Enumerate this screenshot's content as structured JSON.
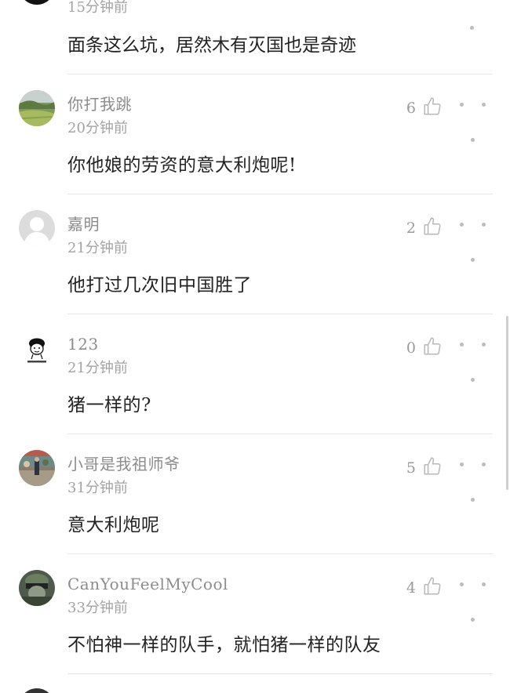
{
  "top": {
    "time": "15分钟前",
    "text": "面条这么坑，居然木有灭国也是奇迹"
  },
  "comments": [
    {
      "user": "你打我跳",
      "time": "20分钟前",
      "text": "你他娘的劳资的意大利炮呢!",
      "likes": "6",
      "avatar": "landscape"
    },
    {
      "user": "嘉明",
      "time": "21分钟前",
      "text": "他打过几次旧中国胜了",
      "likes": "2",
      "avatar": "default"
    },
    {
      "user": "123",
      "time": "21分钟前",
      "text": "猪一样的?",
      "likes": "0",
      "avatar": "meme"
    },
    {
      "user": "小哥是我祖师爷",
      "time": "31分钟前",
      "text": "意大利炮呢",
      "likes": "5",
      "avatar": "street"
    },
    {
      "user": "CanYouFeelMyCool",
      "time": "33分钟前",
      "text": "不怕神一样的队手，就怕猪一样的队友",
      "likes": "4",
      "avatar": "soldier"
    }
  ],
  "icons": {
    "like": "thumbs-up-icon",
    "more": "more-dots-icon"
  },
  "colors": {
    "text": "#222222",
    "meta": "#a3a3a3",
    "icon": "#bcbcbc"
  }
}
